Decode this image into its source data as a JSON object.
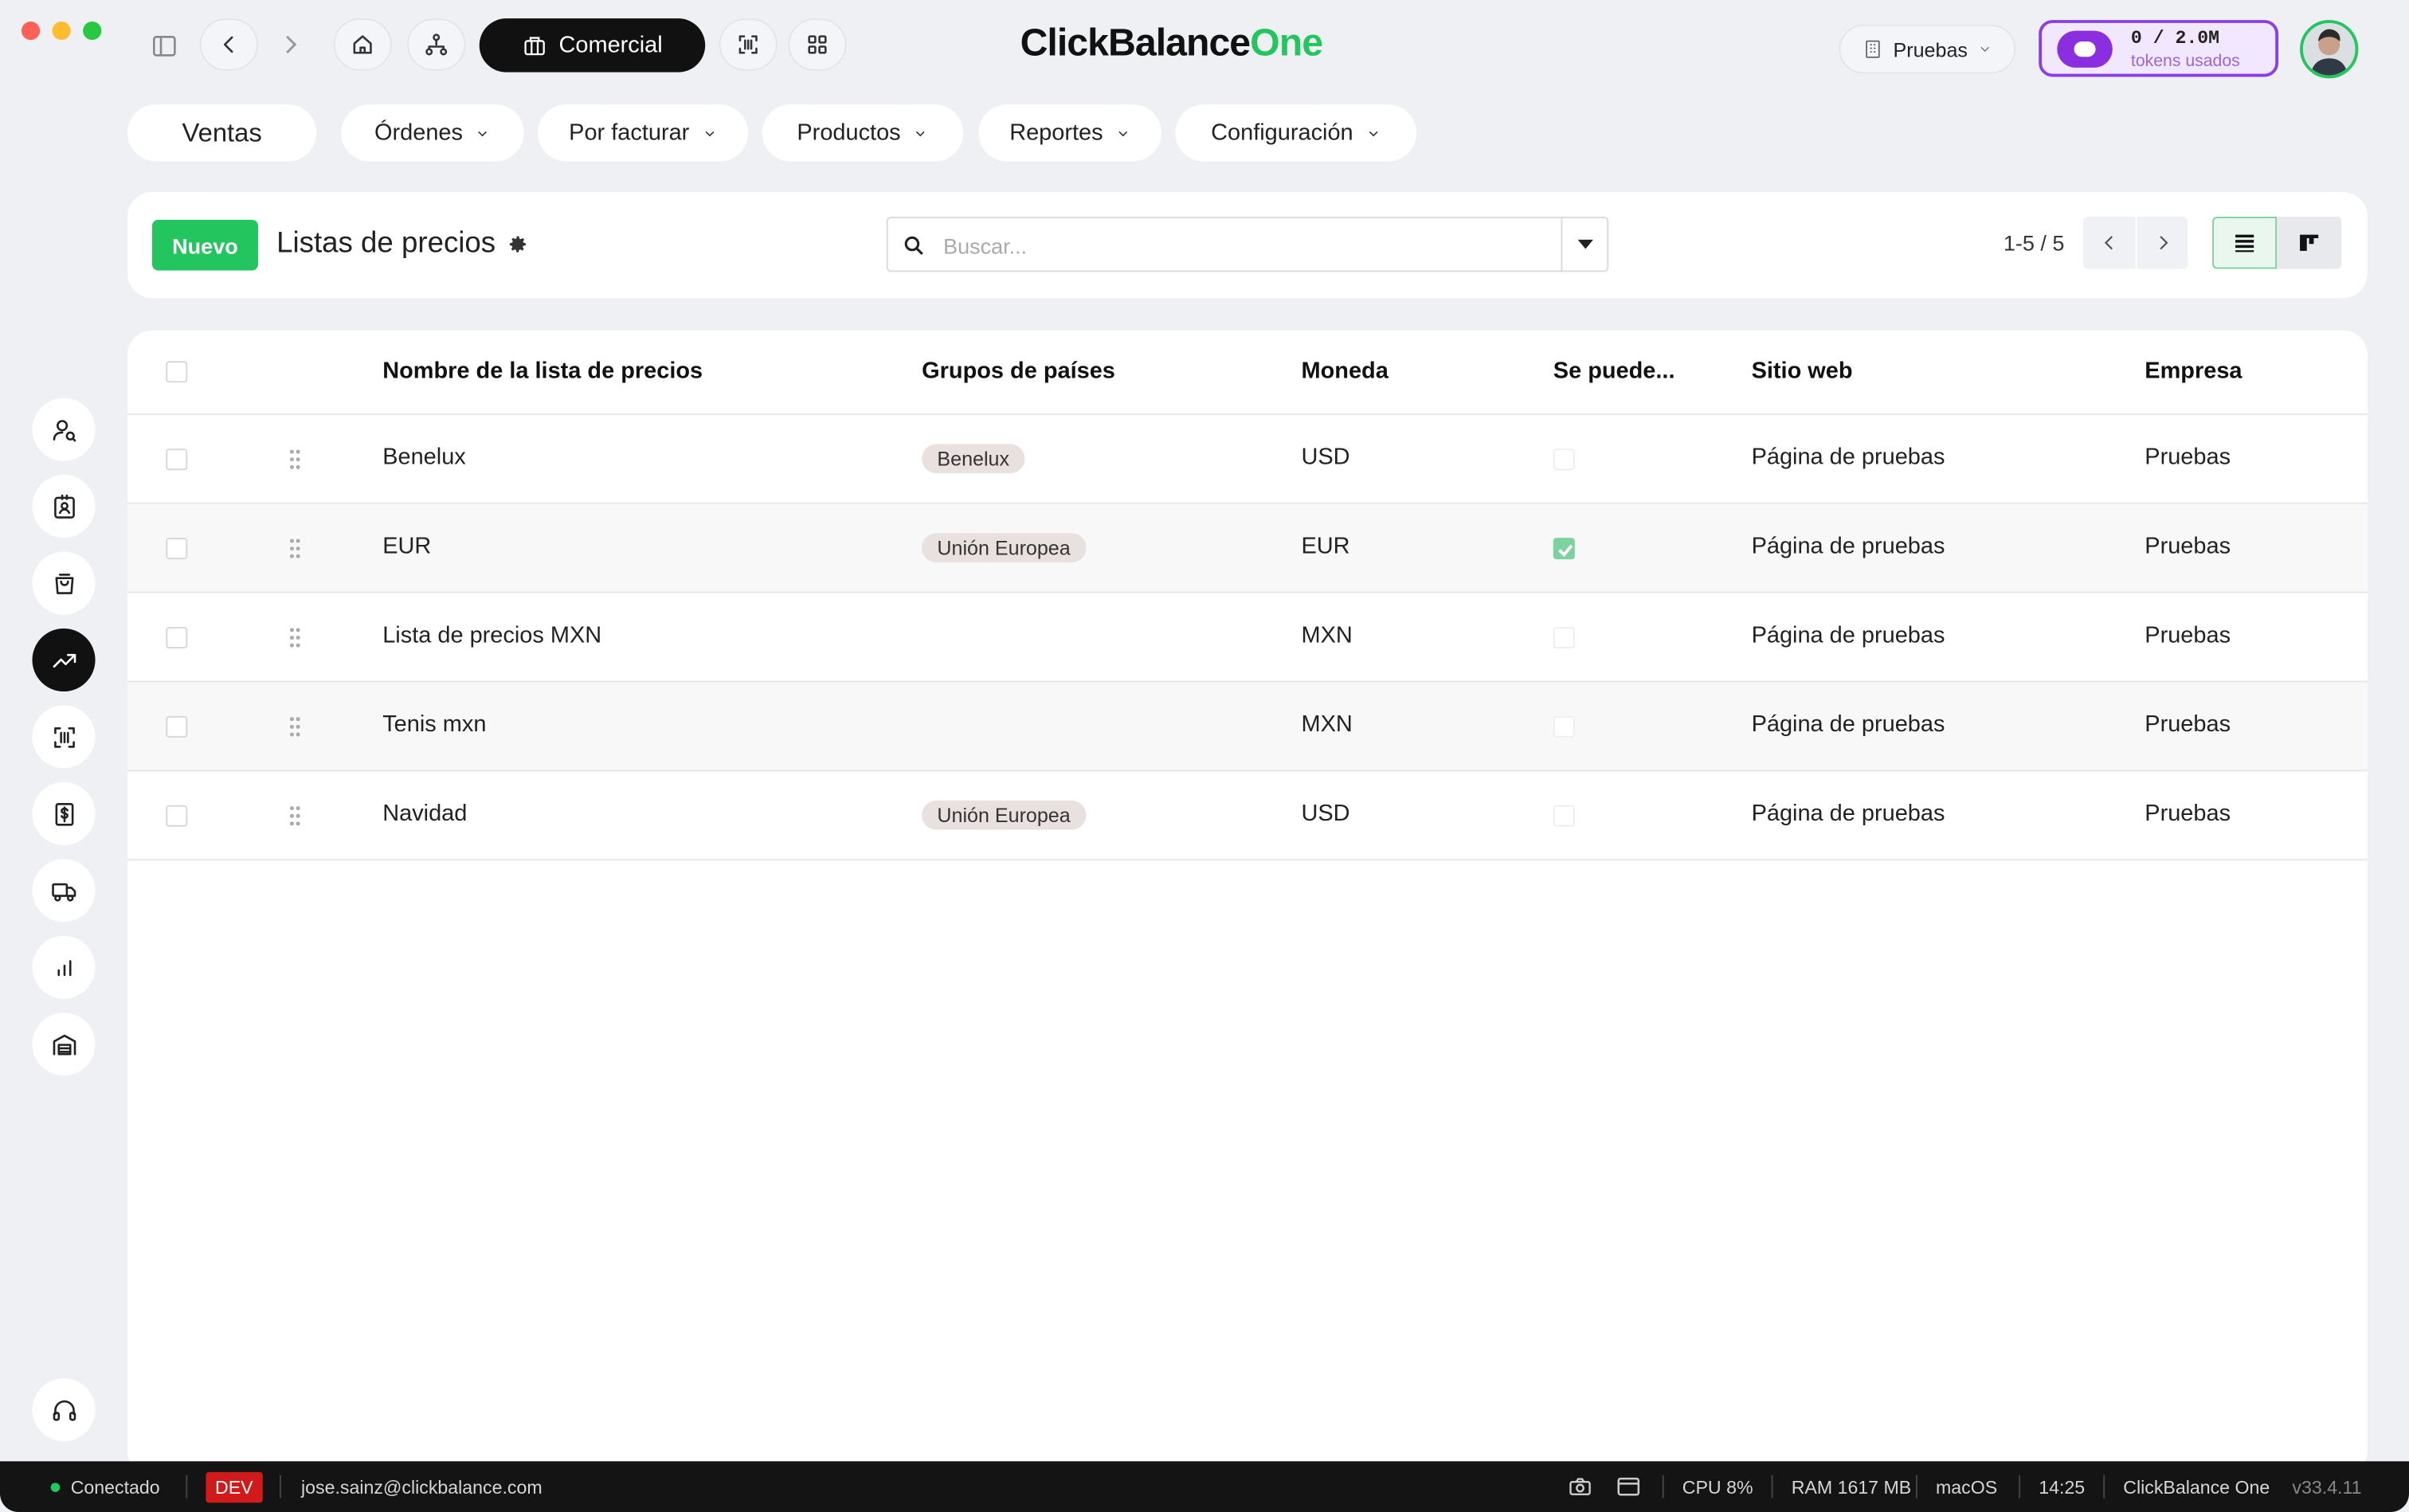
{
  "window": {
    "brand_main": "ClickBalance",
    "brand_accent": "One"
  },
  "toolbar": {
    "app_label": "Comercial",
    "company_label": "Pruebas",
    "tokens_value": "0 / 2.0M",
    "tokens_caption": "tokens usados"
  },
  "nav": {
    "home": "Ventas",
    "items": [
      {
        "label": "Órdenes"
      },
      {
        "label": "Por facturar"
      },
      {
        "label": "Productos"
      },
      {
        "label": "Reportes"
      },
      {
        "label": "Configuración"
      }
    ]
  },
  "controlbar": {
    "new_label": "Nuevo",
    "title": "Listas de precios",
    "search_placeholder": "Buscar...",
    "pager": "1-5 / 5"
  },
  "table": {
    "headers": [
      "Nombre de la lista de precios",
      "Grupos de países",
      "Moneda",
      "Se puede...",
      "Sitio web",
      "Empresa"
    ],
    "rows": [
      {
        "name": "Benelux",
        "group": "Benelux",
        "currency": "USD",
        "selectable": false,
        "website": "Página de pruebas",
        "company": "Pruebas"
      },
      {
        "name": "EUR",
        "group": "Unión Europea",
        "currency": "EUR",
        "selectable": true,
        "website": "Página de pruebas",
        "company": "Pruebas"
      },
      {
        "name": "Lista de precios MXN",
        "group": "",
        "currency": "MXN",
        "selectable": false,
        "website": "Página de pruebas",
        "company": "Pruebas"
      },
      {
        "name": "Tenis mxn",
        "group": "",
        "currency": "MXN",
        "selectable": false,
        "website": "Página de pruebas",
        "company": "Pruebas"
      },
      {
        "name": "Navidad",
        "group": "Unión Europea",
        "currency": "USD",
        "selectable": false,
        "website": "Página de pruebas",
        "company": "Pruebas"
      }
    ]
  },
  "statusbar": {
    "connection": "Conectado",
    "env": "DEV",
    "user": "jose.sainz@clickbalance.com",
    "cpu": "CPU 8%",
    "ram": "RAM 1617 MB",
    "os": "macOS",
    "time": "14:25",
    "app": "ClickBalance One",
    "version": "v33.4.11"
  },
  "colors": {
    "accent": "#22c55e",
    "token_purple": "#8b3ee8",
    "dark": "#111111"
  }
}
